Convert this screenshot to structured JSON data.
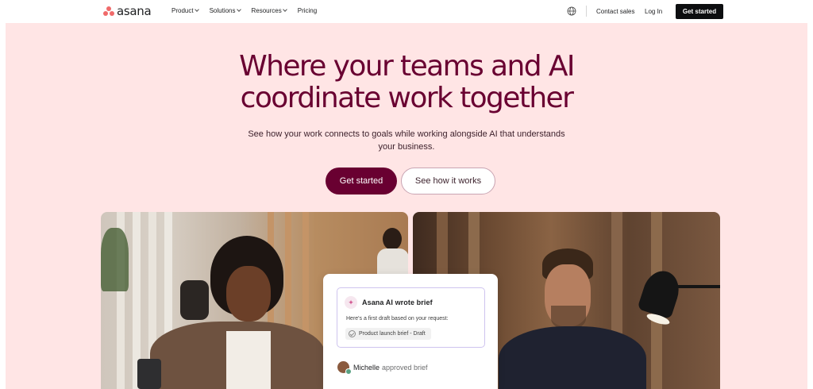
{
  "nav": {
    "logo_text": "asana",
    "menu": [
      {
        "label": "Product",
        "has_dropdown": true
      },
      {
        "label": "Solutions",
        "has_dropdown": true
      },
      {
        "label": "Resources",
        "has_dropdown": true
      },
      {
        "label": "Pricing",
        "has_dropdown": false
      }
    ],
    "globe_icon": "globe-icon",
    "contact_sales": "Contact sales",
    "log_in": "Log In",
    "get_started": "Get started"
  },
  "hero": {
    "headline_line1": "Where your teams and AI",
    "headline_line2": "coordinate work together",
    "subhead": "See how your work connects to goals while working alongside AI that understands your business.",
    "primary_cta": "Get started",
    "secondary_cta": "See how it works"
  },
  "ai_card": {
    "icon": "sparkle-icon",
    "title": "Asana AI wrote brief",
    "body": "Here's a first draft based on your request:",
    "pill": "Product launch brief - Draft",
    "approver_name": "Michelle",
    "approval_text": "approved brief"
  },
  "colors": {
    "brand_primary": "#690031",
    "hero_background": "#ffe5e5",
    "logo_coral": "#f06a6a",
    "nav_cta_background": "#0d0e10"
  }
}
